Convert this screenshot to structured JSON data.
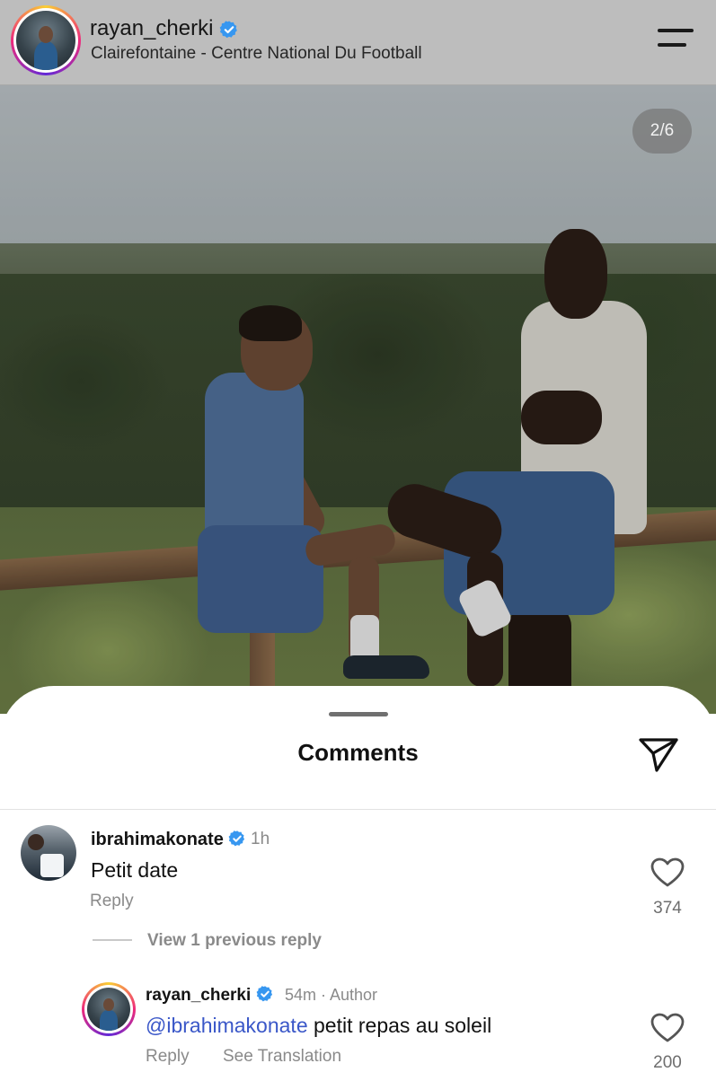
{
  "header": {
    "username": "rayan_cherki",
    "location": "Clairefontaine - Centre National Du Football"
  },
  "post": {
    "counter": "2/6"
  },
  "comments_sheet": {
    "title": "Comments",
    "comments": [
      {
        "username": "ibrahimakonate",
        "verified": true,
        "time": "1h",
        "text": "Petit date",
        "reply_label": "Reply",
        "likes": "374"
      }
    ],
    "view_replies_label": "View 1 previous reply",
    "reply": {
      "username": "rayan_cherki",
      "verified": true,
      "meta": "54m · Author",
      "mention": "@ibrahimakonate",
      "text": " petit repas au soleil",
      "reply_label": "Reply",
      "translation_label": "See Translation",
      "likes": "200"
    }
  },
  "colors": {
    "verified": "#3797f0",
    "mention": "#3a57c8",
    "muted_text": "#8a8a8a"
  },
  "icons": [
    "verified-badge-icon",
    "menu-icon",
    "send-icon",
    "heart-icon"
  ]
}
